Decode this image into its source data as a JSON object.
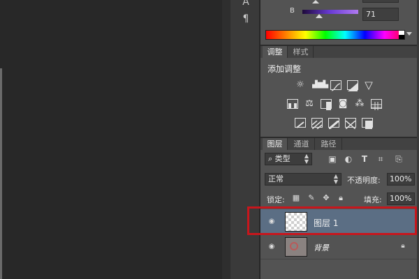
{
  "tool_strip": {
    "icons": [
      "paragraph-icon"
    ]
  },
  "color_panel": {
    "channel_label": "B",
    "channel_value": "71",
    "accent_color": "#7a4fd9"
  },
  "adjustments": {
    "tabs": [
      {
        "label": "调整",
        "active": true
      },
      {
        "label": "样式",
        "active": false
      }
    ],
    "title": "添加调整",
    "rows": [
      [
        "brightness-icon",
        "levels-icon",
        "curves-icon",
        "exposure-icon",
        "gradient-triangle-icon"
      ],
      [
        "vibrance-icon",
        "balance-icon",
        "black-white-icon",
        "photo-filter-icon",
        "channel-mixer-icon",
        "lookup-grid-icon"
      ],
      [
        "invert-icon",
        "posterize-icon",
        "threshold-icon",
        "selective-color-icon",
        "gradient-map-icon"
      ]
    ]
  },
  "layers_panel": {
    "tabs": [
      {
        "label": "图层",
        "active": true
      },
      {
        "label": "通道",
        "active": false
      },
      {
        "label": "路径",
        "active": false
      }
    ],
    "filter": {
      "kind": "类型",
      "icons": [
        "image-filter-icon",
        "adjustment-filter-icon",
        "type-filter-icon",
        "shape-filter-icon",
        "smart-object-filter-icon"
      ]
    },
    "blend_mode": "正常",
    "opacity_label": "不透明度:",
    "opacity_value": "100%",
    "lock_label": "锁定:",
    "lock_icons": [
      "lock-transparency-icon",
      "lock-pixels-icon",
      "lock-position-icon",
      "lock-all-icon"
    ],
    "fill_label": "填充:",
    "fill_value": "100%",
    "layers": [
      {
        "name": "图层 1",
        "selected": true,
        "visible": true,
        "locked": false
      },
      {
        "name": "背景",
        "selected": false,
        "visible": true,
        "locked": true
      }
    ],
    "highlight_color": "#c8161c",
    "selected_row_color": "#5b6e84"
  }
}
